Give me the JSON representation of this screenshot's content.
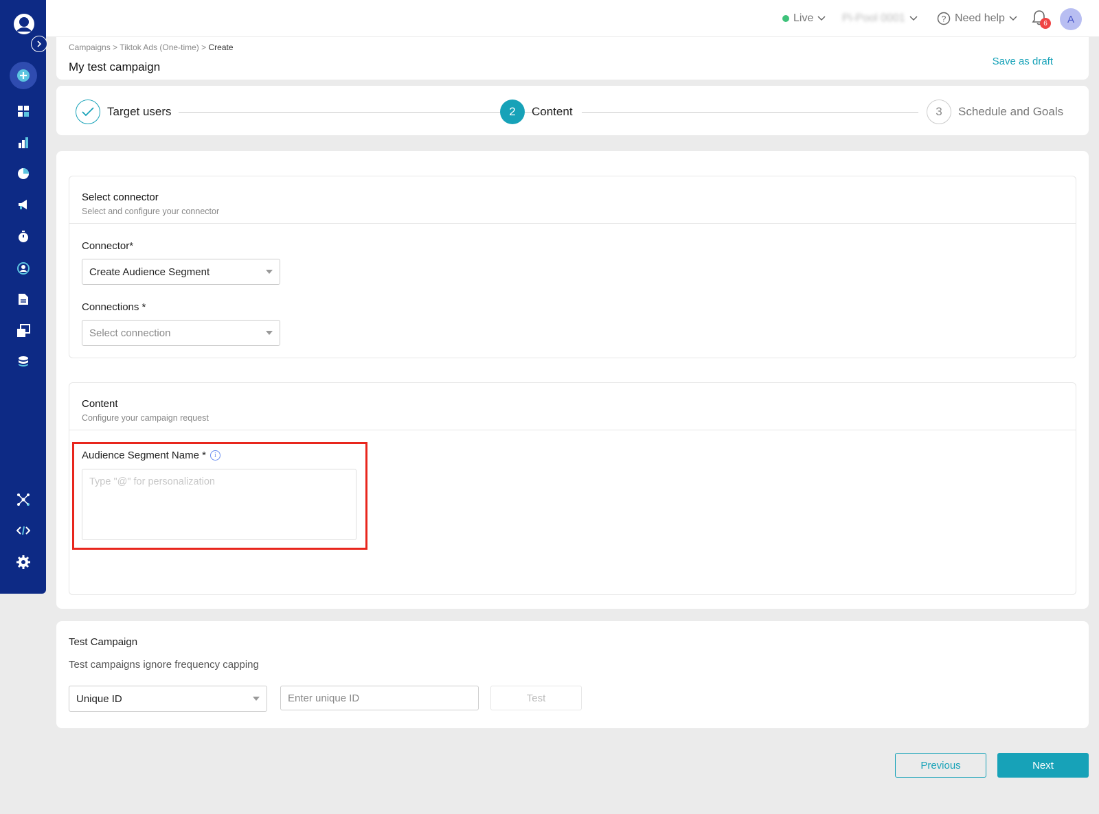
{
  "sidebar": {
    "icons": [
      "profile-logo-icon",
      "expand-icon",
      "add-icon",
      "dashboard-icon",
      "bar-chart-icon",
      "pie-chart-icon",
      "megaphone-icon",
      "timer-icon",
      "user-target-icon",
      "document-icon",
      "gallery-icon",
      "database-icon",
      "integrations-icon",
      "code-icon",
      "gear-icon"
    ]
  },
  "header": {
    "live_label": "Live",
    "workspace_label": "Pi-Pool 0001",
    "help_label": "Need help",
    "notification_count": "6",
    "avatar_initial": "A"
  },
  "breadcrumb": {
    "items": [
      "Campaigns",
      ">",
      "Tiktok Ads (One-time)",
      ">",
      "Create"
    ]
  },
  "page": {
    "title": "My test campaign",
    "save_draft": "Save as draft"
  },
  "stepper": {
    "steps": [
      {
        "number": "",
        "label": "Target users",
        "state": "done"
      },
      {
        "number": "2",
        "label": "Content",
        "state": "active"
      },
      {
        "number": "3",
        "label": "Schedule and Goals",
        "state": "todo"
      }
    ]
  },
  "connector_section": {
    "title": "Select connector",
    "subtitle": "Select and configure your connector",
    "connector_label": "Connector*",
    "connector_value": "Create Audience Segment",
    "connections_label": "Connections *",
    "connections_placeholder": "Select connection"
  },
  "content_section": {
    "title": "Content",
    "subtitle": "Configure your campaign request",
    "segment_label": "Audience Segment Name *",
    "segment_placeholder": "Type \"@\" for personalization"
  },
  "test_campaign": {
    "title": "Test Campaign",
    "subtitle": "Test campaigns ignore frequency capping",
    "id_type_value": "Unique ID",
    "id_input_placeholder": "Enter unique ID",
    "test_button": "Test"
  },
  "footer": {
    "previous": "Previous",
    "next": "Next"
  },
  "colors": {
    "sidebar": "#0d2a85",
    "accent": "#17a2b8",
    "highlight": "#e8261d",
    "live": "#3ec27a"
  }
}
